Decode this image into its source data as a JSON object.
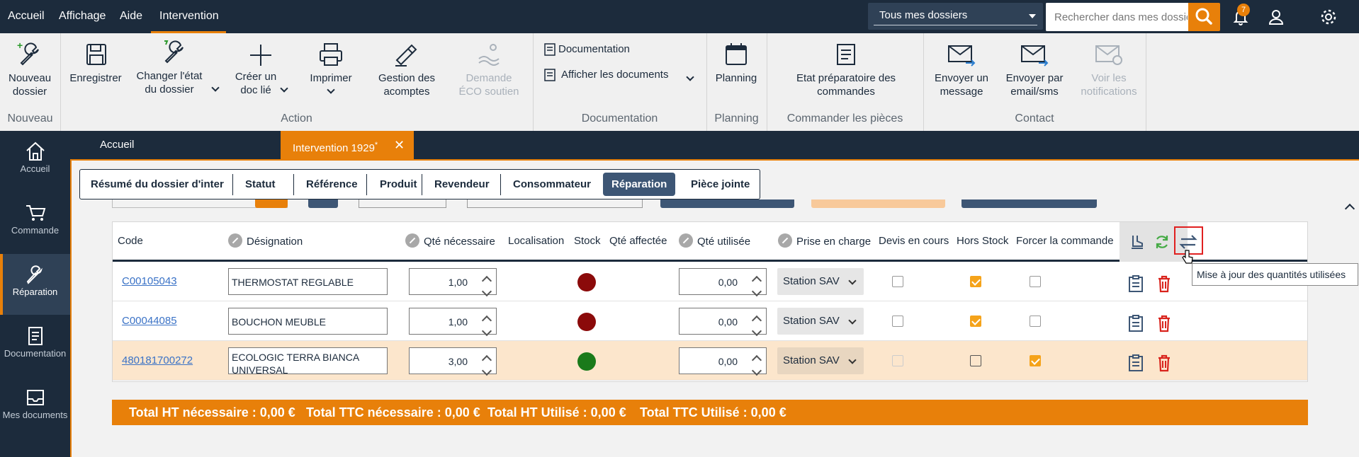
{
  "menu": {
    "items": [
      "Accueil",
      "Affichage",
      "Aide",
      "Intervention"
    ],
    "dossier_select": "Tous mes dossiers",
    "search_placeholder": "Rechercher dans mes dossiers",
    "notifications_count": "7"
  },
  "ribbon": {
    "nouveau_dossier": "Nouveau dossier",
    "enregistrer": "Enregistrer",
    "changer_etat": "Changer l'état du dossier",
    "creer_doc": "Créer un doc lié",
    "imprimer": "Imprimer",
    "gestion_acomptes": "Gestion des acomptes",
    "demande_eco": "Demande ÉCO soutien",
    "documentation": "Documentation",
    "afficher_documents": "Afficher les documents",
    "planning": "Planning",
    "etat_preparatoire": "Etat préparatoire des commandes",
    "envoyer_message": "Envoyer un message",
    "envoyer_email": "Envoyer par email/sms",
    "voir_notifications": "Voir les notifications",
    "groups": {
      "nouveau": "Nouveau",
      "action": "Action",
      "documentation": "Documentation",
      "planning": "Planning",
      "commander": "Commander les pièces",
      "contact": "Contact"
    }
  },
  "sidebar": {
    "items": [
      {
        "label": "Accueil",
        "icon": "home-icon"
      },
      {
        "label": "Commande",
        "icon": "cart-icon"
      },
      {
        "label": "Réparation",
        "icon": "wrench-icon",
        "active": true
      },
      {
        "label": "Documentation",
        "icon": "document-icon"
      },
      {
        "label": "Mes documents",
        "icon": "inbox-icon"
      }
    ]
  },
  "doc_tabs": {
    "accueil": "Accueil",
    "intervention": "Intervention 1929",
    "modified_marker": "*"
  },
  "section_tabs": [
    "Résumé du dossier d'inter",
    "Statut",
    "Référence",
    "Produit",
    "Revendeur",
    "Consommateur",
    "Réparation",
    "Pièce jointe"
  ],
  "active_section_tab": "Réparation",
  "table": {
    "headers": {
      "code": "Code",
      "designation": "Désignation",
      "qte_necessaire": "Qté nécessaire",
      "localisation": "Localisation",
      "stock": "Stock",
      "qte_affectee": "Qté affectée",
      "qte_utilisee": "Qté utilisée",
      "prise_en_charge": "Prise en charge",
      "devis_en_cours": "Devis en cours",
      "hors_stock": "Hors Stock",
      "forcer_commande": "Forcer la commande"
    },
    "rows": [
      {
        "code": "C00105043",
        "designation": "THERMOSTAT REGLABLE",
        "qte_necessaire": "1,00",
        "stock_color": "#8b0a0a",
        "qte_utilisee": "0,00",
        "prise_en_charge": "Station SAV",
        "devis_en_cours": false,
        "hors_stock": true,
        "forcer_commande": false
      },
      {
        "code": "C00044085",
        "designation": "BOUCHON MEUBLE",
        "qte_necessaire": "1,00",
        "stock_color": "#8b0a0a",
        "qte_utilisee": "0,00",
        "prise_en_charge": "Station SAV",
        "devis_en_cours": false,
        "hors_stock": true,
        "forcer_commande": false
      },
      {
        "code": "480181700272",
        "designation": "ECOLOGIC TERRA BIANCA UNIVERSAL",
        "qte_necessaire": "3,00",
        "stock_color": "#1a7a1a",
        "qte_utilisee": "0,00",
        "prise_en_charge": "Station SAV",
        "devis_en_cours": false,
        "hors_stock": false,
        "forcer_commande": true
      }
    ]
  },
  "totals": {
    "ht_necessaire": "Total HT nécessaire : 0,00 €",
    "ttc_necessaire": "Total TTC nécessaire : 0,00 €",
    "ht_utilise": "Total HT Utilisé : 0,00 €",
    "ttc_utilise": "Total TTC Utilisé : 0,00 €"
  },
  "tooltip": "Mise à jour des quantités utilisées",
  "colors": {
    "accent": "#e8800a",
    "navy": "#1c2b3c",
    "delete": "#d9231c",
    "refresh": "#44aa44"
  }
}
